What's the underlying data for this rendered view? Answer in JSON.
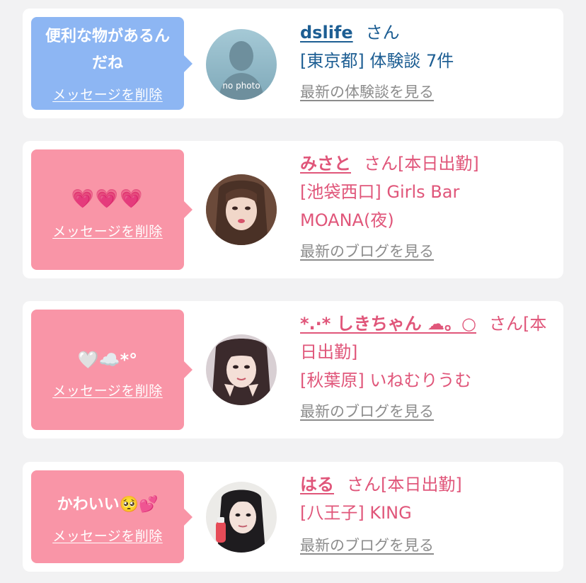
{
  "cards": [
    {
      "message": "便利な物があるんだね",
      "delete_label": "メッセージを削除",
      "name": "dslife",
      "suffix": "さん",
      "detail_lines": [
        "[東京都] 体験談 7件"
      ],
      "more_label": "最新の体験談を見る",
      "avatar_text": "no photo"
    },
    {
      "message": "💗💗💗",
      "delete_label": "メッセージを削除",
      "name": "みさと",
      "suffix": "さん[本日出勤]",
      "detail_lines": [
        "[池袋西口] Girls Bar",
        "MOANA(夜)"
      ],
      "more_label": "最新のブログを見る"
    },
    {
      "message": "🤍☁️*°",
      "delete_label": "メッセージを削除",
      "name": "*.·* しきちゃん ☁︎。○",
      "suffix": "さん[本",
      "suffix_wrap": "日出勤]",
      "detail_lines": [
        "[秋葉原] いねむりうむ"
      ],
      "more_label": "最新のブログを見る"
    },
    {
      "message": "かわいい🥺💕",
      "delete_label": "メッセージを削除",
      "name": "はる",
      "suffix": "さん[本日出勤]",
      "detail_lines": [
        "[八王子] KING"
      ],
      "more_label": "最新のブログを見る"
    }
  ],
  "colors": {
    "page_bg": "#f2f2f3",
    "bubble_blue": "#8db6f3",
    "bubble_pink": "#f995a7",
    "text_blue": "#1d5e93",
    "text_pink": "#e0567a",
    "link_gray": "#8c8c8c"
  }
}
